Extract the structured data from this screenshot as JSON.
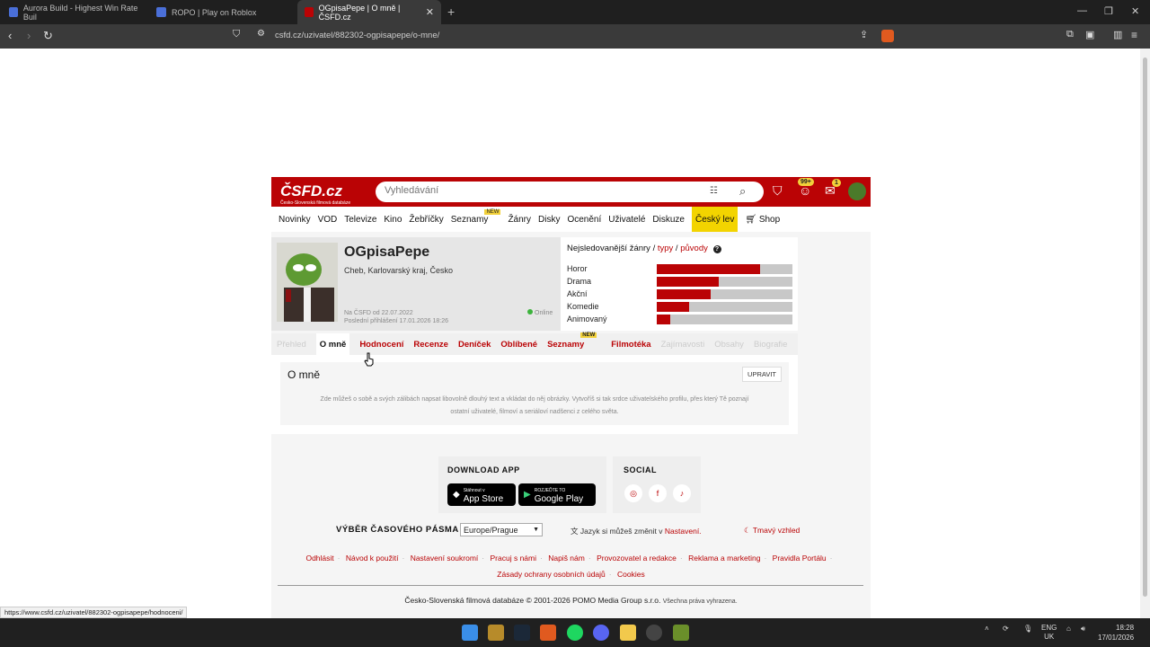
{
  "browser": {
    "tabs": [
      {
        "title": "Aurora Build - Highest Win Rate Buil"
      },
      {
        "title": "ROPO | Play on Roblox"
      },
      {
        "title": "OGpisaPepe | O mně | ČSFD.cz"
      }
    ],
    "url": "csfd.cz/uzivatel/882302-ogpisapepe/o-mne/",
    "status_url": "https://www.csfd.cz/uzivatel/882302-ogpisapepe/hodnoceni/"
  },
  "site": {
    "logo": "ČSFD.cz",
    "logo_sub": "Česko-Slovenská filmová databáze",
    "search_placeholder": "Vyhledávání",
    "notif_badge": "99+",
    "msg_badge": "1",
    "menu": [
      "Novinky",
      "VOD",
      "Televize",
      "Kino",
      "Žebříčky",
      "Seznamy",
      "Žánry",
      "Disky",
      "Ocenění",
      "Uživatelé",
      "Diskuze",
      "Český lev",
      "Shop"
    ],
    "new_label": "NEW"
  },
  "profile": {
    "name": "OGpisaPepe",
    "location": "Cheb, Karlovarský kraj, Česko",
    "member_since": "Na ČSFD od 22.07.2022",
    "last_login": "Poslední přihlášení 17.01.2026 18:26",
    "online": "Online"
  },
  "genres": {
    "title": "Nejsledovanější žánry",
    "links": [
      "typy",
      "původy"
    ],
    "items": [
      {
        "label": "Horor",
        "value": 0.76
      },
      {
        "label": "Drama",
        "value": 0.46
      },
      {
        "label": "Akční",
        "value": 0.4
      },
      {
        "label": "Komedie",
        "value": 0.24
      },
      {
        "label": "Animovaný",
        "value": 0.1
      }
    ]
  },
  "profile_tabs": [
    "Přehled",
    "O mně",
    "Hodnocení",
    "Recenze",
    "Deníček",
    "Oblíbené",
    "Seznamy",
    "Filmotéka",
    "Zajímavosti",
    "Obsahy",
    "Biografie"
  ],
  "about": {
    "title": "O mně",
    "edit": "UPRAVIT",
    "text1": "Zde můžeš o sobě a svých zálibách napsat libovolně dlouhý text a vkládat do něj obrázky. Vytvoříš si tak srdce uživatelského profilu, přes který Tě poznají",
    "text2": "ostatní uživatelé, filmoví a seriáloví nadšenci z celého světa."
  },
  "footer": {
    "download_title": "DOWNLOAD APP",
    "appstore_small": "Stáhnout v",
    "appstore": "App Store",
    "googleplay_small": "ROZJEĎTE TO",
    "googleplay": "Google Play",
    "social_title": "SOCIAL",
    "tz_label": "VÝBĚR ČASOVÉHO PÁSMA",
    "tz_value": "Europe/Prague",
    "lang_text": "Jazyk si můžeš změnit v",
    "lang_link": "Nastavení.",
    "dark": "Tmavý vzhled",
    "links": [
      "Odhlásit",
      "Návod k použití",
      "Nastavení soukromí",
      "Pracuj s námi",
      "Napiš nám",
      "Provozovatel a redakce",
      "Reklama a marketing",
      "Pravidla Portálu"
    ],
    "links2": [
      "Zásady ochrany osobních údajů",
      "Cookies"
    ],
    "copyright": "Česko-Slovenská filmová databáze © 2001-2026 POMO Media Group s.r.o.",
    "rights": "Všechna práva vyhrazena."
  },
  "taskbar": {
    "lang": "ENG",
    "region": "UK",
    "time": "18:28",
    "date": "17/01/2026"
  }
}
